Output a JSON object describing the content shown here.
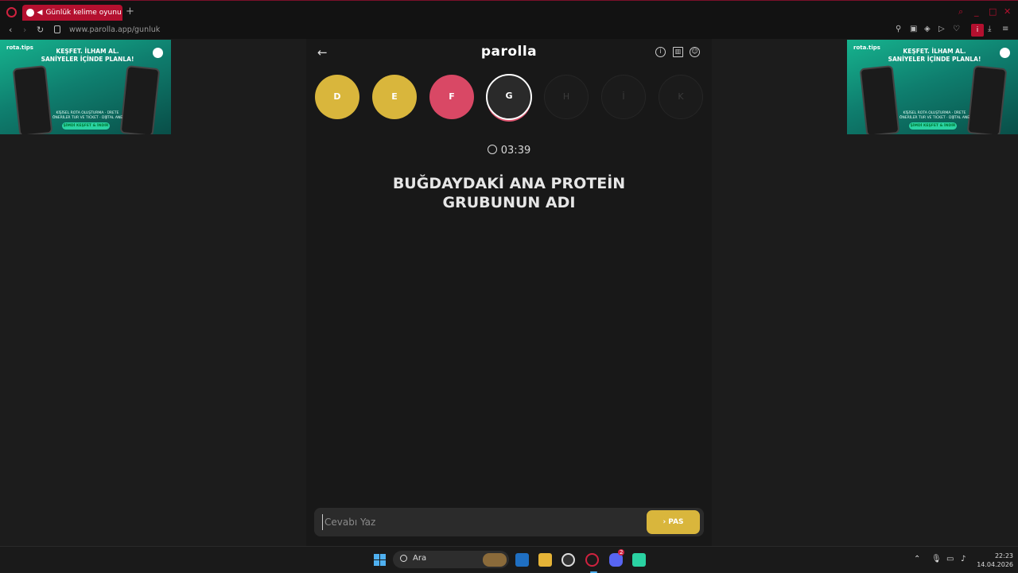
{
  "browser": {
    "tab_title": "Günlük kelime oyunu -",
    "speaker_icon": "speaker-icon",
    "new_tab_symbol": "+",
    "url": "www.parolla.app/gunluk",
    "profile_letter": "i"
  },
  "ads": {
    "brand": "rota.tips",
    "headline": "KEŞFET. İLHAM AL. SANİYELER İÇİNDE PLANLA!",
    "sub": "KİŞİSEL ROTA OLUŞTURMA · ÜRETE ÖNERİLER TUR VE TICKET · DİJİTAL ANE",
    "cta": "ŞİMDİ KEŞFET & İNDİR"
  },
  "game": {
    "title": "parolla",
    "back_symbol": "←",
    "letters": [
      {
        "letter": "D",
        "state": "correct"
      },
      {
        "letter": "E",
        "state": "correct"
      },
      {
        "letter": "F",
        "state": "wrong"
      },
      {
        "letter": "G",
        "state": "current"
      },
      {
        "letter": "H",
        "state": "pending"
      },
      {
        "letter": "İ",
        "state": "pending"
      },
      {
        "letter": "K",
        "state": "pending"
      }
    ],
    "timer": "03:39",
    "question": "BUĞDAYDAKİ ANA PROTEİN GRUBUNUN ADI",
    "answer_placeholder": "Cevabı Yaz",
    "pass_label": "› PAS"
  },
  "taskbar": {
    "search_label": "Ara",
    "time": "22:23",
    "date": "14.04.2026",
    "discord_badge": "2"
  },
  "colors": {
    "accent_red": "#b4102f",
    "correct": "#d9b63c",
    "wrong": "#d94865"
  }
}
